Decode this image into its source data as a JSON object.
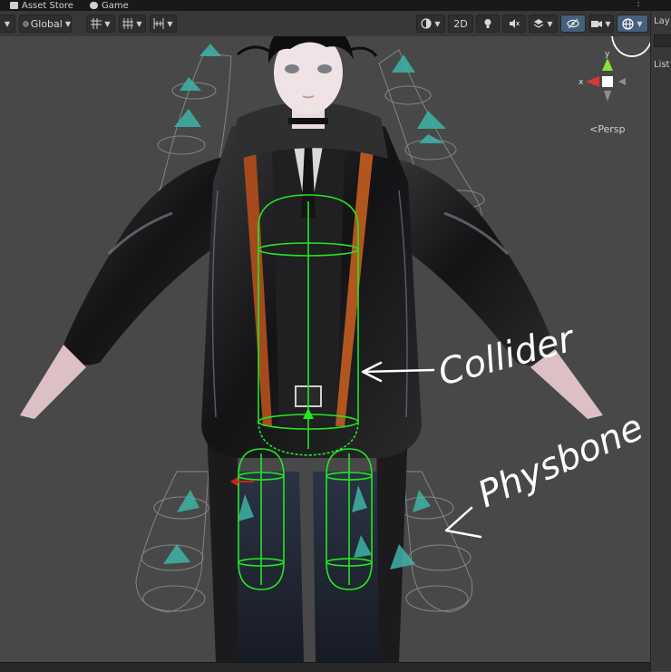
{
  "tabs": [
    {
      "label": "Asset Store",
      "icon": "bag-icon"
    },
    {
      "label": "Game",
      "icon": "gamepad-icon"
    }
  ],
  "toolbar": {
    "pivot_mode_label": "Global",
    "mode_2d_label": "2D"
  },
  "gizmo": {
    "x_label": "x",
    "y_label": "y",
    "projection_label": "Persp"
  },
  "annotations": {
    "collider_label": "Collider",
    "physbone_label": "Physbone"
  },
  "right_panel": {
    "header_label": "Lay",
    "list_label": "List"
  },
  "colors": {
    "collider_gizmo": "#22e622",
    "physbone_gizmo": "#3fb3a7",
    "annotation_ink": "#ffffff",
    "toolbar_active": "#46607c"
  }
}
